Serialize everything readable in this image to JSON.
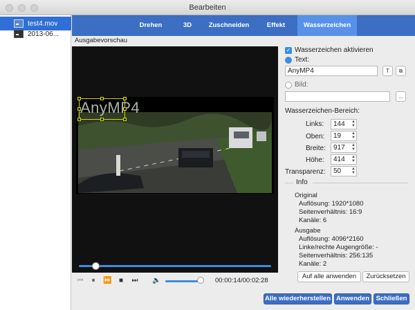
{
  "window": {
    "title": "Bearbeiten"
  },
  "files": [
    {
      "name": "test4.mov",
      "selected": true
    },
    {
      "name": "2013-06...",
      "selected": false
    }
  ],
  "tabs": [
    {
      "label": "Drehen",
      "active": false
    },
    {
      "label": "3D",
      "active": false
    },
    {
      "label": "Zuschneiden",
      "active": false
    },
    {
      "label": "Effekt",
      "active": false
    },
    {
      "label": "Wasserzeichen",
      "active": true
    }
  ],
  "preview": {
    "label": "Ausgabevorschau",
    "watermark_text": "AnyMP4",
    "time": "00:00:14/00:02:28"
  },
  "watermark": {
    "enable_label": "Wasserzeichen aktivieren",
    "text_label": "Text:",
    "text_value": "AnyMP4",
    "image_label": "Bild:",
    "image_value": "",
    "browse_label": "...",
    "area_label": "Wasserzeichen-Bereich:",
    "left_label": "Links:",
    "left_value": "144",
    "top_label": "Oben:",
    "top_value": "19",
    "width_label": "Breite:",
    "width_value": "917",
    "height_label": "Höhe:",
    "height_value": "414",
    "transparency_label": "Transparenz:",
    "transparency_value": "50"
  },
  "info": {
    "title": "Info",
    "original_title": "Original",
    "original_resolution": "Auflösung: 1920*1080",
    "original_aspect": "Seitenverhältnis: 16:9",
    "original_channels": "Kanäle: 6",
    "output_title": "Ausgabe",
    "output_resolution": "Auflösung: 4096*2160",
    "output_eye": "Linke/rechte Augengröße: -",
    "output_aspect": "Seitenverhältnis: 256:135",
    "output_channels": "Kanäle: 2"
  },
  "buttons": {
    "apply_all": "Auf alle anwenden",
    "reset": "Zurücksetzen",
    "restore_all": "Alle wiederherstellen",
    "apply": "Anwenden",
    "close": "Schließen"
  },
  "colors": {
    "accent": "#3b8de0",
    "tab_bar": "#3c6ec3",
    "tab_active": "#5891e8",
    "selection": "#2f6fd6",
    "watermark_box": "#d8d800"
  }
}
